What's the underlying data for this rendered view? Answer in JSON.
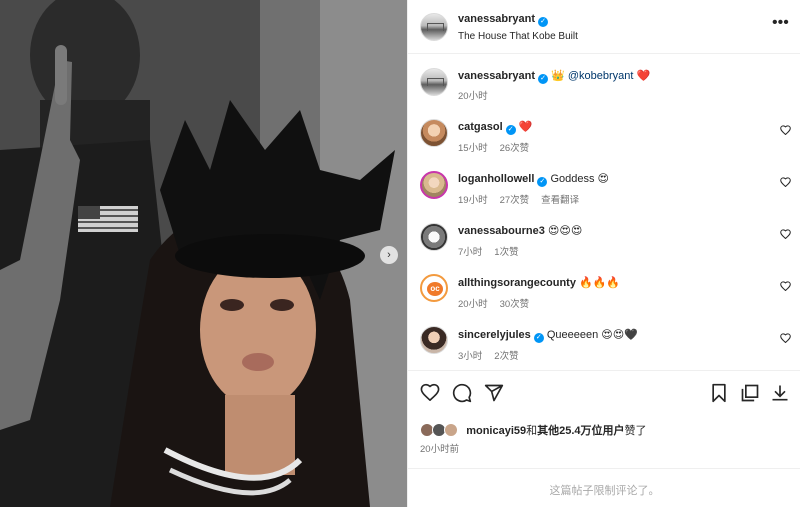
{
  "post": {
    "author": "vanessabryant",
    "location": "The House That Kobe Built",
    "caption": {
      "username": "vanessabryant",
      "crown_emoji": "👑",
      "mention": "@kobebryant",
      "heart_emoji": "❤️",
      "time": "20小时"
    },
    "photo_description_icon": "photo-icon",
    "carousel_next": "›"
  },
  "comments": [
    {
      "username": "catgasol",
      "verified": true,
      "text": "❤️",
      "time": "15小时",
      "likes": "26次赞",
      "extra": ""
    },
    {
      "username": "loganhollowell",
      "verified": true,
      "text": "Goddess 😍",
      "time": "19小时",
      "likes": "27次赞",
      "extra": "查看翻译"
    },
    {
      "username": "vanessabourne3",
      "verified": false,
      "text": "😍😍😍",
      "time": "7小时",
      "likes": "1次赞",
      "extra": ""
    },
    {
      "username": "allthingsorangecounty",
      "verified": false,
      "text": "🔥🔥🔥",
      "time": "20小时",
      "likes": "30次赞",
      "extra": ""
    },
    {
      "username": "sincerelyjules",
      "verified": true,
      "text": "Queeeeen 😍😍🖤",
      "time": "3小时",
      "likes": "2次赞",
      "extra": ""
    }
  ],
  "actions": {
    "like_icon": "heart-outline-icon",
    "comment_icon": "comment-icon",
    "share_icon": "paper-plane-icon",
    "save_icon": "bookmark-icon",
    "add_to_collection_icon": "copy-icon",
    "download_icon": "download-icon"
  },
  "likes": {
    "first_user": "monicayi59",
    "joiner": "和",
    "others": "其他25.4万位用户",
    "suffix": "赞了"
  },
  "post_time": "20小时前",
  "comments_limited": "这篇帖子限制评论了。",
  "verified_mark": "✓",
  "more_menu": "•••"
}
